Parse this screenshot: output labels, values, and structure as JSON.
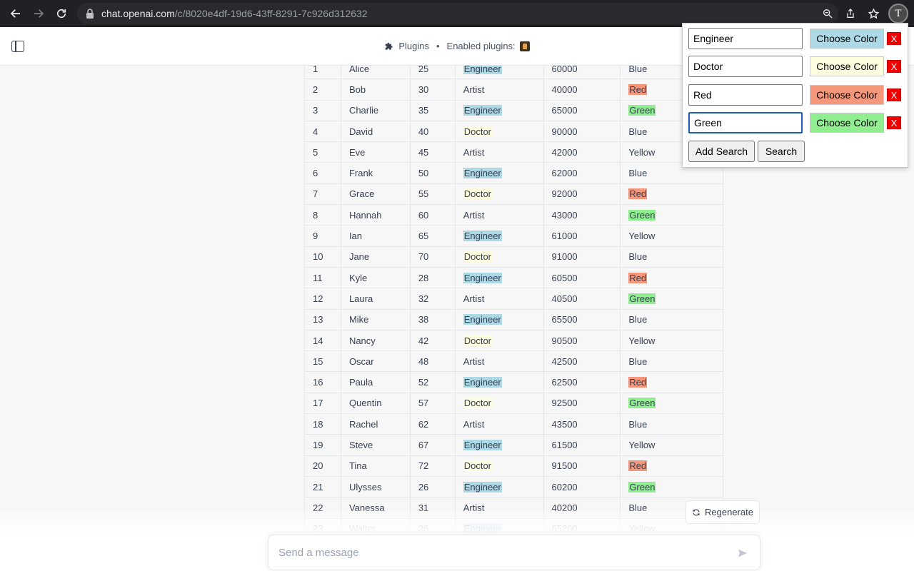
{
  "browser": {
    "url_host": "chat.openai.com",
    "url_path": "/c/8020e4df-19d6-43ff-8291-7c926d312632",
    "profile_letter": "T"
  },
  "header": {
    "plugins_label": "Plugins",
    "separator": "•",
    "enabled_label": "Enabled plugins:"
  },
  "table": {
    "rows": [
      {
        "id": "1",
        "name": "Alice",
        "age": "25",
        "job": "Engineer",
        "salary": "60000",
        "color": "Blue"
      },
      {
        "id": "2",
        "name": "Bob",
        "age": "30",
        "job": "Artist",
        "salary": "40000",
        "color": "Red"
      },
      {
        "id": "3",
        "name": "Charlie",
        "age": "35",
        "job": "Engineer",
        "salary": "65000",
        "color": "Green"
      },
      {
        "id": "4",
        "name": "David",
        "age": "40",
        "job": "Doctor",
        "salary": "90000",
        "color": "Blue"
      },
      {
        "id": "5",
        "name": "Eve",
        "age": "45",
        "job": "Artist",
        "salary": "42000",
        "color": "Yellow"
      },
      {
        "id": "6",
        "name": "Frank",
        "age": "50",
        "job": "Engineer",
        "salary": "62000",
        "color": "Blue"
      },
      {
        "id": "7",
        "name": "Grace",
        "age": "55",
        "job": "Doctor",
        "salary": "92000",
        "color": "Red"
      },
      {
        "id": "8",
        "name": "Hannah",
        "age": "60",
        "job": "Artist",
        "salary": "43000",
        "color": "Green"
      },
      {
        "id": "9",
        "name": "Ian",
        "age": "65",
        "job": "Engineer",
        "salary": "61000",
        "color": "Yellow"
      },
      {
        "id": "10",
        "name": "Jane",
        "age": "70",
        "job": "Doctor",
        "salary": "91000",
        "color": "Blue"
      },
      {
        "id": "11",
        "name": "Kyle",
        "age": "28",
        "job": "Engineer",
        "salary": "60500",
        "color": "Red"
      },
      {
        "id": "12",
        "name": "Laura",
        "age": "32",
        "job": "Artist",
        "salary": "40500",
        "color": "Green"
      },
      {
        "id": "13",
        "name": "Mike",
        "age": "38",
        "job": "Engineer",
        "salary": "65500",
        "color": "Blue"
      },
      {
        "id": "14",
        "name": "Nancy",
        "age": "42",
        "job": "Doctor",
        "salary": "90500",
        "color": "Yellow"
      },
      {
        "id": "15",
        "name": "Oscar",
        "age": "48",
        "job": "Artist",
        "salary": "42500",
        "color": "Blue"
      },
      {
        "id": "16",
        "name": "Paula",
        "age": "52",
        "job": "Engineer",
        "salary": "62500",
        "color": "Red"
      },
      {
        "id": "17",
        "name": "Quentin",
        "age": "57",
        "job": "Doctor",
        "salary": "92500",
        "color": "Green"
      },
      {
        "id": "18",
        "name": "Rachel",
        "age": "62",
        "job": "Artist",
        "salary": "43500",
        "color": "Blue"
      },
      {
        "id": "19",
        "name": "Steve",
        "age": "67",
        "job": "Engineer",
        "salary": "61500",
        "color": "Yellow"
      },
      {
        "id": "20",
        "name": "Tina",
        "age": "72",
        "job": "Doctor",
        "salary": "91500",
        "color": "Red"
      },
      {
        "id": "21",
        "name": "Ulysses",
        "age": "26",
        "job": "Engineer",
        "salary": "60200",
        "color": "Green"
      },
      {
        "id": "22",
        "name": "Vanessa",
        "age": "31",
        "job": "Artist",
        "salary": "40200",
        "color": "Blue"
      },
      {
        "id": "23",
        "name": "Walter",
        "age": "36",
        "job": "Engineer",
        "salary": "65200",
        "color": "Yellow"
      }
    ]
  },
  "highlights": {
    "Engineer": "#add8e6",
    "Doctor": "#fffde0",
    "Red": "#f4977a",
    "Green": "#90ee90"
  },
  "popup": {
    "terms": [
      {
        "value": "Engineer",
        "button": "Choose Color",
        "color": "#add8e6",
        "remove": "X"
      },
      {
        "value": "Doctor",
        "button": "Choose Color",
        "color": "#fffde0",
        "remove": "X"
      },
      {
        "value": "Red",
        "button": "Choose Color",
        "color": "#f4977a",
        "remove": "X"
      },
      {
        "value": "Green",
        "button": "Choose Color",
        "color": "#90ee90",
        "remove": "X"
      }
    ],
    "add_search_label": "Add Search",
    "search_label": "Search"
  },
  "regenerate_label": "Regenerate",
  "composer": {
    "placeholder": "Send a message"
  }
}
